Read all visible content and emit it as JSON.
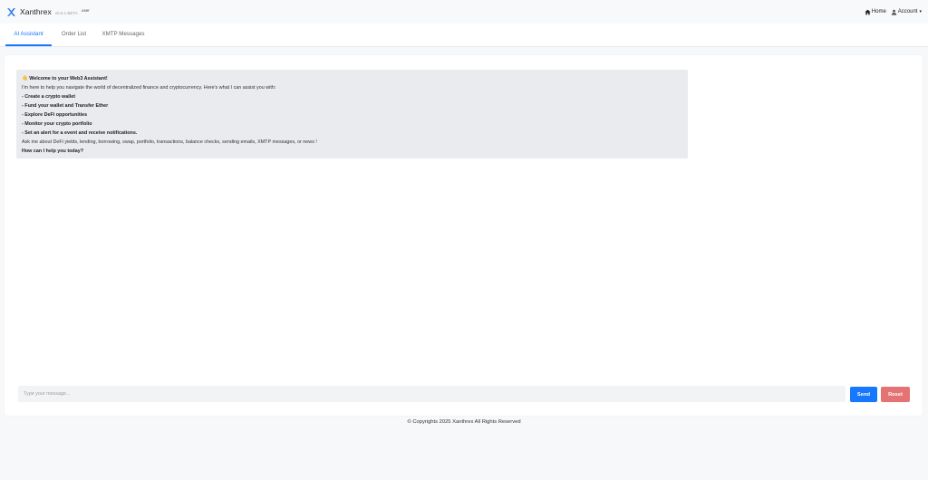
{
  "navbar": {
    "brand_name": "Xanthrex",
    "version": "v0.0.1 BETA",
    "user": "user",
    "home_label": "Home",
    "account_label": "Account",
    "accent_color": "#1677ff"
  },
  "tabs": [
    {
      "label": "AI Assistant",
      "active": true
    },
    {
      "label": "Order List",
      "active": false
    },
    {
      "label": "XMTP Messages",
      "active": false
    }
  ],
  "message": {
    "title": "👋 Welcome to your Web3 Assistant!",
    "intro": "I'm here to help you navigate the world of decentralized finance and cryptocurrency. Here's what I can assist you with:",
    "items": [
      "- Create a crypto wallet",
      "- Fund your wallet and Transfer Ether",
      "- Explore DeFi opportunities",
      "- Monitor your crypto portfolio",
      "- Set an alert for a event and receive notifications."
    ],
    "outro": "Ask me about DeFi yields, lending, borrowing, swap, portfolio, transactions, balance checks, sending emails, XMTP messages, or news !",
    "question": "How can I help you today?"
  },
  "chat": {
    "placeholder": "Type your message...",
    "value": "",
    "send_label": "Send",
    "reset_label": "Reset",
    "send_color": "#1677ff",
    "reset_color": "#e57373"
  },
  "footer": {
    "text": "© Copyrights 2025 Xanthrex All Rights Reserved"
  },
  "icons": {
    "brand": "x-logo-icon",
    "home": "home-icon",
    "account": "user-icon",
    "caret": "chevron-down-icon"
  }
}
